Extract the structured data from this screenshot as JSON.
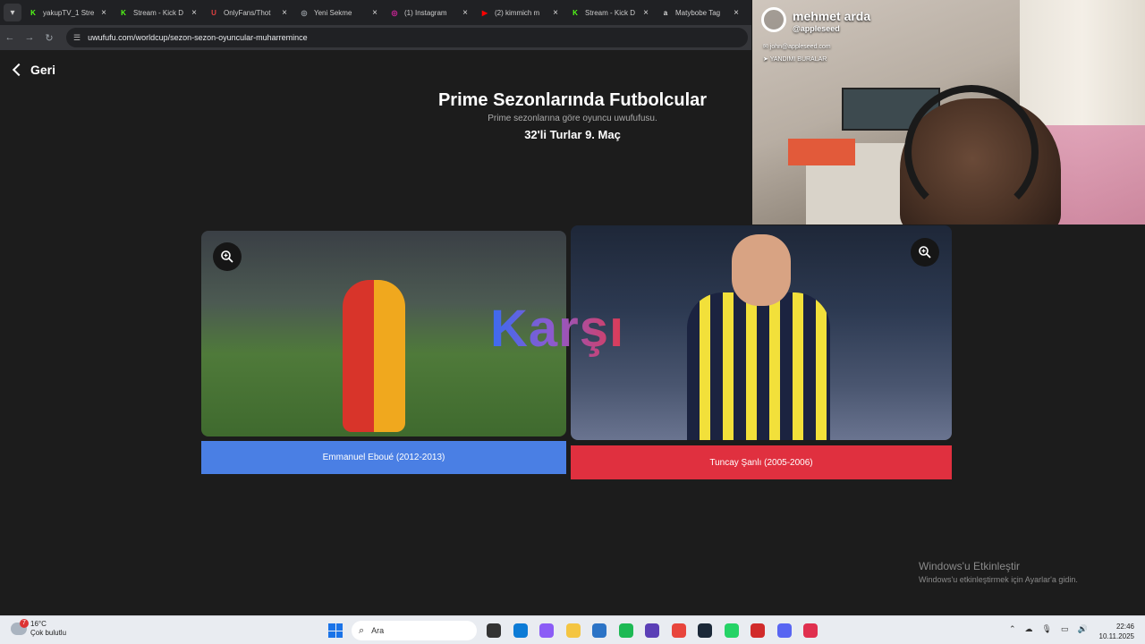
{
  "browser": {
    "tabs": [
      {
        "title": "yakupTV_1 Stre",
        "favicon_color": "#53fc18",
        "favicon_text": "K"
      },
      {
        "title": "Stream - Kick D",
        "favicon_color": "#53fc18",
        "favicon_text": "K"
      },
      {
        "title": "OnlyFans/Thot",
        "favicon_color": "#e04040",
        "favicon_text": "U"
      },
      {
        "title": "Yeni Sekme",
        "favicon_color": "#9aa0a6",
        "favicon_text": "◎"
      },
      {
        "title": "(1) Instagram",
        "favicon_color": "#d6249f",
        "favicon_text": "◎"
      },
      {
        "title": "(2) kimmich m",
        "favicon_color": "#ff0000",
        "favicon_text": "▶"
      },
      {
        "title": "Stream - Kick D",
        "favicon_color": "#53fc18",
        "favicon_text": "K"
      },
      {
        "title": "Matybobe Tag",
        "favicon_color": "#dddddd",
        "favicon_text": "a"
      }
    ],
    "url": "uwufufu.com/worldcup/sezon-sezon-oyuncular-muharremince"
  },
  "page": {
    "back_label": "Geri",
    "title": "Prime Sezonlarında Futbolcular",
    "subtitle": "Prime sezonlarına göre oyuncu uwufufusu.",
    "round": "32'li Turlar 9. Maç",
    "vs_label": "Karşı",
    "left_player": "Emmanuel Eboué (2012-2013)",
    "right_player": "Tuncay Şanlı (2005-2006)"
  },
  "webcam": {
    "name": "mehmet arda",
    "handle": "@appleseed",
    "email": "john@appleseed.com",
    "location": "YANDIMI BURALAR"
  },
  "watermark": {
    "title": "Windows'u Etkinleştir",
    "subtitle": "Windows'u etkinleştirmek için Ayarlar'a gidin."
  },
  "taskbar": {
    "weather_badge": "7",
    "temperature": "16°C",
    "condition": "Çok bulutlu",
    "search_placeholder": "Ara",
    "time": "22:46",
    "date": "10.11.2025",
    "icons": [
      {
        "name": "task-view-icon",
        "color": "#333333"
      },
      {
        "name": "edge-icon",
        "color": "#0c7bd6"
      },
      {
        "name": "copilot-icon",
        "color": "#8b5cf6"
      },
      {
        "name": "file-explorer-icon",
        "color": "#f4c542"
      },
      {
        "name": "store-icon",
        "color": "#2b73c6"
      },
      {
        "name": "spotify-icon",
        "color": "#1db954"
      },
      {
        "name": "app-icon",
        "color": "#5b3fb6"
      },
      {
        "name": "chrome-icon",
        "color": "#e8453c"
      },
      {
        "name": "steam-icon",
        "color": "#1b2838"
      },
      {
        "name": "whatsapp-icon",
        "color": "#25d366"
      },
      {
        "name": "media-player-icon",
        "color": "#d12b2b"
      },
      {
        "name": "discord-icon",
        "color": "#5865f2"
      },
      {
        "name": "app2-icon",
        "color": "#e0304f"
      }
    ]
  }
}
